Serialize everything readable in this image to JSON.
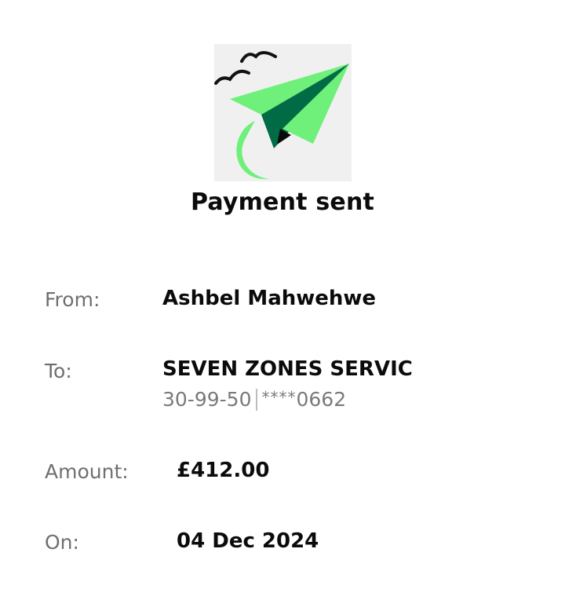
{
  "hero": {
    "icon": "paper-plane-illustration-icon"
  },
  "title": "Payment sent",
  "from": {
    "label": "From:",
    "value": "Ashbel Mahwehwe"
  },
  "to": {
    "label": "To:",
    "name": "SEVEN ZONES SERVIC",
    "sort_code": "30-99-50",
    "account_mask": "****",
    "account_suffix": "0662"
  },
  "amount": {
    "label": "Amount:",
    "value": "£412.00"
  },
  "date": {
    "label": "On:",
    "value": "04 Dec 2024"
  },
  "colors": {
    "plane_light": "#6ef07a",
    "plane_dark": "#006b45",
    "birds": "#111111",
    "hero_bg": "#f0f0f0"
  }
}
